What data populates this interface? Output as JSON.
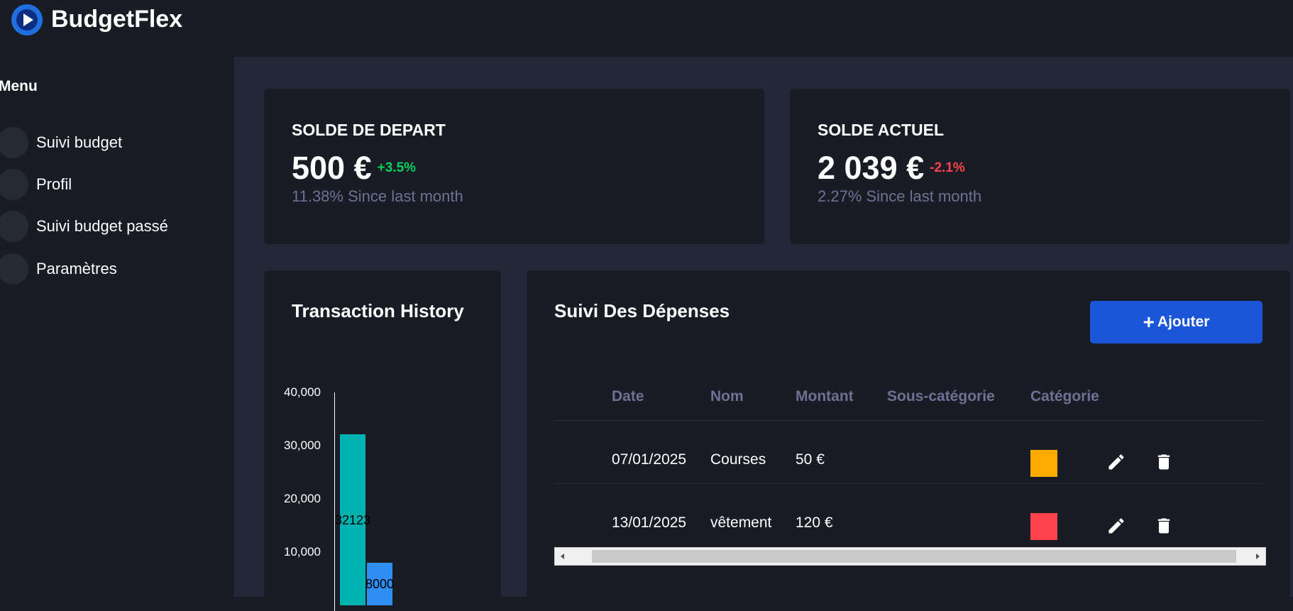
{
  "app": {
    "brand": "BudgetFlex"
  },
  "colors": {
    "accent": "#1b56da",
    "positive": "#00d25b",
    "negative": "#fc424a",
    "muted": "#6c7293"
  },
  "sidebar": {
    "title": "Menu",
    "items": [
      {
        "label": "Suivi budget"
      },
      {
        "label": "Profil"
      },
      {
        "label": "Suivi budget passé"
      },
      {
        "label": "Paramètres"
      }
    ]
  },
  "stats": [
    {
      "title": "SOLDE DE DEPART",
      "value": "500 €",
      "change": "+3.5%",
      "trend": "positive",
      "sub": "11.38% Since last month"
    },
    {
      "title": "SOLDE ACTUEL",
      "value": "2 039 €",
      "change": "-2.1%",
      "trend": "negative",
      "sub": "2.27% Since last month"
    }
  ],
  "history": {
    "title": "Transaction History",
    "chart_data": {
      "type": "bar",
      "categories": [
        "",
        ""
      ],
      "values": [
        32123,
        8000
      ],
      "value_labels": [
        "32123",
        "8000"
      ],
      "colors": [
        "#00b3b0",
        "#2e8ef2"
      ],
      "yticks": [
        "40,000",
        "30,000",
        "20,000",
        "10,000"
      ],
      "ylim": [
        0,
        40000
      ]
    }
  },
  "expenses": {
    "title": "Suivi Des Dépenses",
    "add_label": "Ajouter",
    "columns": [
      "Date",
      "Nom",
      "Montant",
      "Sous-catégorie",
      "Catégorie"
    ],
    "rows": [
      {
        "date": "07/01/2025",
        "nom": "Courses",
        "montant": "50 €",
        "sous_categorie": "",
        "categorie_color": "#ffab00"
      },
      {
        "date": "13/01/2025",
        "nom": "vêtement",
        "montant": "120 €",
        "sous_categorie": "",
        "categorie_color": "#fc424a"
      }
    ]
  }
}
